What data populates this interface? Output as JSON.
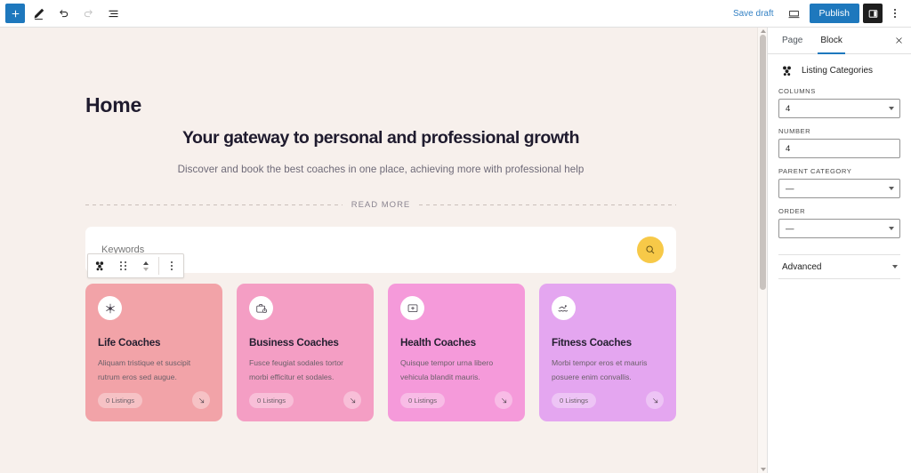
{
  "topbar": {
    "add_block_label": "+",
    "save_draft_label": "Save draft",
    "publish_label": "Publish",
    "tools_icon": "pencil-icon",
    "undo_icon": "undo-icon",
    "redo_icon": "redo-icon",
    "listview_icon": "list-view-icon",
    "preview_icon": "preview-desktop-icon",
    "settings_icon": "settings-panel-icon",
    "options_icon": "kebab-menu-icon",
    "accent_color": "#1e78bd"
  },
  "canvas": {
    "background_color": "#f7f0ec",
    "page_title": "Home",
    "hero": {
      "heading": "Your gateway to personal and professional growth",
      "subheading": "Discover and book the best coaches in one place, achieving more with professional help"
    },
    "read_more_label": "READ MORE",
    "search": {
      "placeholder": "Keywords",
      "value": "",
      "button_icon": "search-icon",
      "button_color": "#f7c948"
    },
    "block_toolbar": {
      "block_icon": "listing-categories-icon",
      "drag_icon": "drag-handle-icon",
      "move_up_icon": "chevron-up-icon",
      "move_down_icon": "chevron-down-icon",
      "options_icon": "kebab-menu-icon"
    },
    "cards": [
      {
        "title": "Life Coaches",
        "description": "Aliquam tristique et suscipit rutrum eros sed augue.",
        "listings": "0 Listings",
        "color": "#f2a3a8",
        "icon": "snowflake-icon",
        "arrow_icon": "arrow-down-right-icon"
      },
      {
        "title": "Business Coaches",
        "description": "Fusce feugiat sodales tortor morbi efficitur et sodales.",
        "listings": "0 Listings",
        "color": "#f49ec4",
        "icon": "briefcase-clock-icon",
        "arrow_icon": "arrow-down-right-icon"
      },
      {
        "title": "Health Coaches",
        "description": "Quisque tempor urna libero vehicula blandit mauris.",
        "listings": "0 Listings",
        "color": "#f59ada",
        "icon": "monitor-plus-icon",
        "arrow_icon": "arrow-down-right-icon"
      },
      {
        "title": "Fitness Coaches",
        "description": "Morbi tempor eros et mauris posuere enim convallis.",
        "listings": "0 Listings",
        "color": "#e4a6f0",
        "icon": "swimmer-icon",
        "arrow_icon": "arrow-down-right-icon"
      }
    ]
  },
  "sidebar": {
    "tabs": [
      {
        "label": "Page",
        "active": false
      },
      {
        "label": "Block",
        "active": true
      }
    ],
    "close_icon": "close-icon",
    "block": {
      "icon": "listing-categories-icon",
      "name": "Listing Categories"
    },
    "fields": [
      {
        "label": "COLUMNS",
        "value": "4",
        "type": "select"
      },
      {
        "label": "NUMBER",
        "value": "4",
        "type": "number"
      },
      {
        "label": "PARENT CATEGORY",
        "value": "—",
        "type": "select"
      },
      {
        "label": "ORDER",
        "value": "—",
        "type": "select"
      }
    ],
    "advanced_label": "Advanced"
  }
}
